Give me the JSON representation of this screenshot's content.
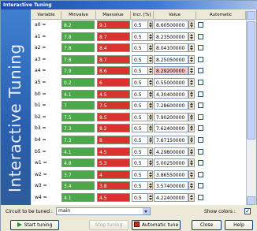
{
  "window": {
    "title": "Interactive Tuning"
  },
  "sidebar": {
    "label": "Interactive Tuning"
  },
  "columns": [
    "Variable",
    "Minvalue",
    "Maxvalue",
    "Incr. [%]",
    "Value",
    "Automatic"
  ],
  "rows": [
    {
      "name": "a0 =",
      "min": "8.2",
      "max": "9.1",
      "incr": "0.5",
      "value": "8.60500000",
      "value_bg": "#ffffff"
    },
    {
      "name": "a1 =",
      "min": "7.8",
      "max": "8.7",
      "incr": "0.5",
      "value": "8.23500000",
      "value_bg": "#ffffff"
    },
    {
      "name": "a2 =",
      "min": "7.8",
      "max": "8.4",
      "incr": "0.5",
      "value": "8.04100000",
      "value_bg": "#ffffff"
    },
    {
      "name": "a3 =",
      "min": "7.8",
      "max": "8.7",
      "incr": "0.5",
      "value": "8.25050000",
      "value_bg": "#ffffff"
    },
    {
      "name": "a4 =",
      "min": "7.9",
      "max": "8.6",
      "incr": "0.5",
      "value": "8.29200000",
      "value_bg": "#f4c6c6"
    },
    {
      "name": "a5 =",
      "min": "0.2",
      "max": "6",
      "incr": "0.5",
      "value": "0.55000000",
      "value_bg": "#ffffff"
    },
    {
      "name": "b0 =",
      "min": "4.1",
      "max": "4.5",
      "incr": "0.5",
      "value": "4.30400000",
      "value_bg": "#ffffff"
    },
    {
      "name": "b1 =",
      "min": "7",
      "max": "7.5",
      "incr": "0.5",
      "value": "7.28600000",
      "value_bg": "#ffffff"
    },
    {
      "name": "b2 =",
      "min": "7.5",
      "max": "8.5",
      "incr": "0.5",
      "value": "7.90200000",
      "value_bg": "#ffffff"
    },
    {
      "name": "b3 =",
      "min": "7.3",
      "max": "8.2",
      "incr": "0.5",
      "value": "7.62400000",
      "value_bg": "#ffffff"
    },
    {
      "name": "b4 =",
      "min": "7.3",
      "max": "8",
      "incr": "0.5",
      "value": "7.67150000",
      "value_bg": "#ffffff"
    },
    {
      "name": "b5 =",
      "min": "4.1",
      "max": "4.5",
      "incr": "0.5",
      "value": "4.29800000",
      "value_bg": "#ffffff"
    },
    {
      "name": "w1 =",
      "min": "4.8",
      "max": "5.3",
      "incr": "0.5",
      "value": "5.00250000",
      "value_bg": "#ffffff"
    },
    {
      "name": "w2 =",
      "min": "3.7",
      "max": "4",
      "incr": "0.5",
      "value": "3.86550000",
      "value_bg": "#ffffff"
    },
    {
      "name": "w3 =",
      "min": "3.4",
      "max": "3.8",
      "incr": "0.5",
      "value": "3.57400000",
      "value_bg": "#ffffff"
    },
    {
      "name": "w4 =",
      "min": "4.1",
      "max": "4.5",
      "incr": "0.5",
      "value": "4.22400000",
      "value_bg": "#ffffff"
    }
  ],
  "footer": {
    "circuit_label": "Circuit to be tuned :",
    "circuit_value": "main",
    "show_colors_label": "Show colors :",
    "show_colors_checked": "✓",
    "buttons": {
      "start": "Start tuning",
      "stop": "Stop tuning",
      "automatic": "Automatic tune",
      "close": "Close",
      "help": "Help"
    }
  },
  "colors": {
    "min_cell": "#4aa848",
    "max_cell": "#d8332f",
    "accent": "#2a5fb0"
  }
}
